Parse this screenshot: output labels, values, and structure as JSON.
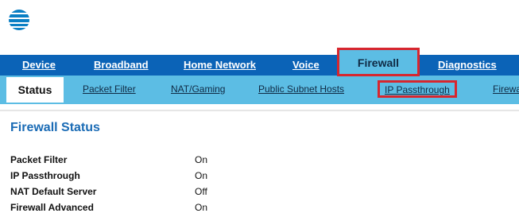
{
  "colors": {
    "nav_bar": "#0b63b7",
    "sub_bar": "#5cbde4",
    "highlight_border": "#d7262e",
    "section_title": "#1a6bb5"
  },
  "logo": {
    "icon": "att-globe-logo"
  },
  "top_nav": {
    "items": [
      {
        "label": "Device"
      },
      {
        "label": "Broadband"
      },
      {
        "label": "Home Network"
      },
      {
        "label": "Voice"
      },
      {
        "label": "Firewall",
        "active": true
      },
      {
        "label": "Diagnostics"
      }
    ]
  },
  "sub_nav": {
    "items": [
      {
        "label": "Status",
        "active": true
      },
      {
        "label": "Packet Filter"
      },
      {
        "label": "NAT/Gaming"
      },
      {
        "label": "Public Subnet Hosts"
      },
      {
        "label": "IP Passthrough",
        "highlighted": true
      },
      {
        "label": "Firewall"
      }
    ]
  },
  "section": {
    "title": "Firewall Status",
    "rows": [
      {
        "label": "Packet Filter",
        "value": "On"
      },
      {
        "label": "IP Passthrough",
        "value": "On"
      },
      {
        "label": "NAT Default Server",
        "value": "Off"
      },
      {
        "label": "Firewall Advanced",
        "value": "On"
      }
    ]
  }
}
